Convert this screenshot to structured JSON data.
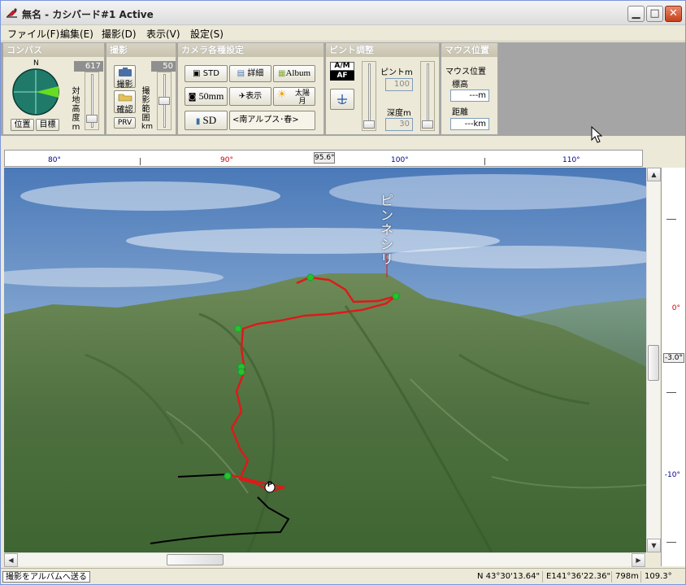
{
  "window": {
    "title": "無名 - カシバード#1 Active"
  },
  "menu": [
    {
      "label": "ファイル(F)"
    },
    {
      "label": "編集(E)"
    },
    {
      "label": "撮影(D)"
    },
    {
      "label": "表示(V)"
    },
    {
      "label": "設定(S)"
    }
  ],
  "compass": {
    "title": "コンパス",
    "north_label": "N",
    "altitude_value": "617",
    "altitude_label": [
      "対",
      "地",
      "高",
      "度",
      "m"
    ],
    "position_button": "位置",
    "target_button": "目標"
  },
  "shoot": {
    "title": "撮影",
    "capture_button": "撮影",
    "confirm_button": "確認",
    "prv_button": "PRV",
    "range_value": "50",
    "range_label": [
      "撮",
      "影",
      "範",
      "囲",
      "km"
    ]
  },
  "camera": {
    "title": "カメラ各種設定",
    "std_button": "STD",
    "detail_button": "詳細",
    "album_button": "Album",
    "lens_button": "50mm",
    "display_button": "表示",
    "sun_moon_button": "太陽月",
    "sd_button": "SD",
    "preset_text": "<南アルプス･春>"
  },
  "focus": {
    "title": "ピント調整",
    "am_label": "A/M",
    "af_label": "AF",
    "focus_label": "ピントm",
    "focus_value": "100",
    "depth_label": "深度m",
    "depth_value": "30"
  },
  "mouse": {
    "title": "マウス位置",
    "subtitle": "マウス位置",
    "elevation_label": "標高",
    "elevation_value": "---m",
    "distance_label": "距離",
    "distance_value": "---km"
  },
  "ruler": {
    "labels": [
      {
        "text": "80°",
        "color": "#00008b"
      },
      {
        "text": "90°",
        "color": "#cc0000"
      },
      {
        "text": "100°",
        "color": "#00008b"
      },
      {
        "text": "110°",
        "color": "#00008b"
      }
    ],
    "heading": "95.6°"
  },
  "pitch": {
    "labels": [
      {
        "text": "0°",
        "color": "#cc0000"
      },
      {
        "text": "-3.0°",
        "color": "#000000"
      },
      {
        "text": "-10°",
        "color": "#00008b"
      }
    ]
  },
  "scene": {
    "peak_label": "ピンネシリ",
    "marker_label": "P"
  },
  "status": {
    "hint": "撮影をアルバムへ送る",
    "lat": "N 43°30'13.64\"",
    "lon": "E141°36'22.36\"",
    "elev": "798m",
    "heading": "109.3°"
  }
}
